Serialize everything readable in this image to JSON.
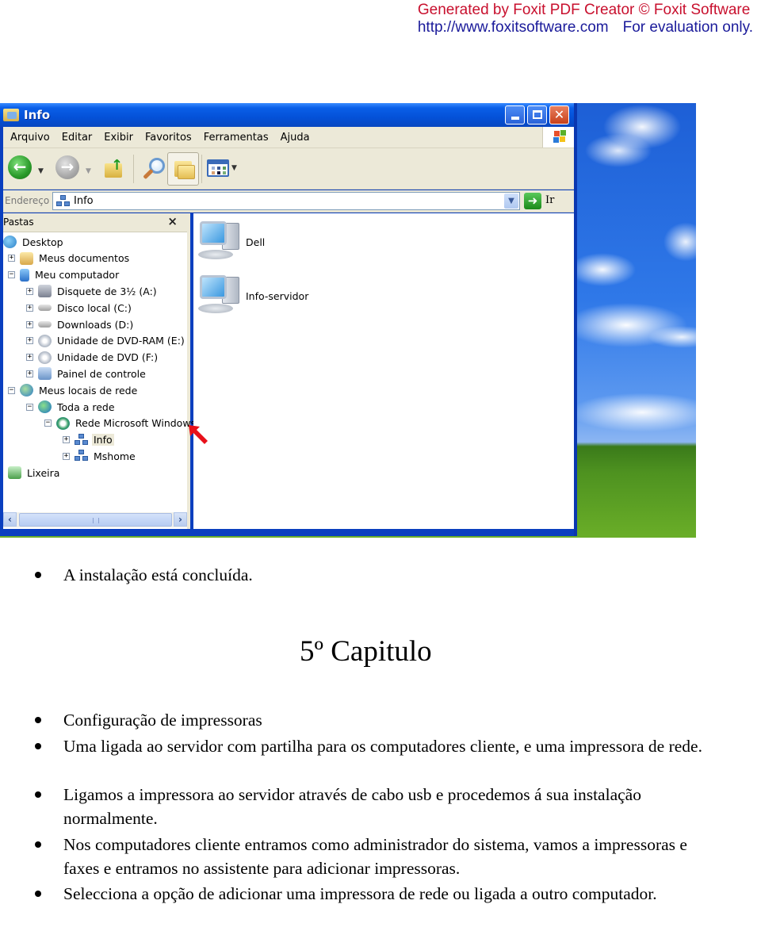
{
  "watermark": {
    "line1": "Generated by Foxit PDF Creator © Foxit Software",
    "url": "http://www.foxitsoftware.com",
    "note": "For evaluation only."
  },
  "explorer": {
    "window_title": "Info",
    "title_icon": "folder-icon",
    "window_buttons": [
      "minimize",
      "maximize",
      "close"
    ],
    "menu": [
      "Arquivo",
      "Editar",
      "Exibir",
      "Favoritos",
      "Ferramentas",
      "Ajuda"
    ],
    "toolbar": {
      "back_icon": "back-arrow-icon",
      "forward_icon": "forward-arrow-icon",
      "up_icon": "folder-up-icon",
      "search_icon": "search-icon",
      "folders_icon": "folders-icon",
      "views_icon": "views-icon"
    },
    "address": {
      "label": "Endereço",
      "value": "Info",
      "go_label": "Ir"
    },
    "folders_pane": {
      "title": "Pastas",
      "close_glyph": "×",
      "tree": [
        {
          "label": "Desktop",
          "level": 0,
          "expander": "",
          "icon": "desktop"
        },
        {
          "label": "Meus documentos",
          "level": 1,
          "expander": "+",
          "icon": "docs"
        },
        {
          "label": "Meu computador",
          "level": 1,
          "expander": "−",
          "icon": "mycomp"
        },
        {
          "label": "Disquete de 3½ (A:)",
          "level": 2,
          "expander": "+",
          "icon": "floppy"
        },
        {
          "label": "Disco local (C:)",
          "level": 2,
          "expander": "+",
          "icon": "disk"
        },
        {
          "label": "Downloads (D:)",
          "level": 2,
          "expander": "+",
          "icon": "disk"
        },
        {
          "label": "Unidade de DVD-RAM (E:)",
          "level": 2,
          "expander": "+",
          "icon": "dvd"
        },
        {
          "label": "Unidade de DVD (F:)",
          "level": 2,
          "expander": "+",
          "icon": "dvd"
        },
        {
          "label": "Painel de controle",
          "level": 2,
          "expander": "+",
          "icon": "cp"
        },
        {
          "label": "Meus locais de rede",
          "level": 1,
          "expander": "−",
          "icon": "netplaces"
        },
        {
          "label": "Toda a rede",
          "level": 2,
          "expander": "−",
          "icon": "world"
        },
        {
          "label": "Rede Microsoft Windows",
          "level": 3,
          "expander": "−",
          "icon": "msnet"
        },
        {
          "label": "Info",
          "level": 4,
          "expander": "+",
          "icon": "workgroup",
          "selected": true
        },
        {
          "label": "Mshome",
          "level": 4,
          "expander": "+",
          "icon": "workgroup"
        },
        {
          "label": "Lixeira",
          "level": 1,
          "expander": "",
          "icon": "trash"
        }
      ]
    },
    "content_items": [
      {
        "label": "Dell",
        "icon": "computer-icon"
      },
      {
        "label": "Info-servidor",
        "icon": "computer-icon"
      }
    ],
    "annotation_arrow_color": "#e8101a"
  },
  "document": {
    "intro_bullet": "A instalação está concluída.",
    "chapter_title": "5º Capitulo",
    "bullets": [
      "Configuração de impressoras",
      "Uma ligada ao servidor com partilha para os computadores cliente, e uma impressora de rede.",
      "Ligamos a impressora ao servidor através de cabo usb e procedemos á sua instalação normalmente.",
      "Nos computadores cliente entramos como administrador do sistema, vamos a impressoras e faxes e entramos no assistente para adicionar impressoras.",
      "Selecciona a opção de adicionar uma impressora de rede ou ligada a outro computador."
    ]
  }
}
